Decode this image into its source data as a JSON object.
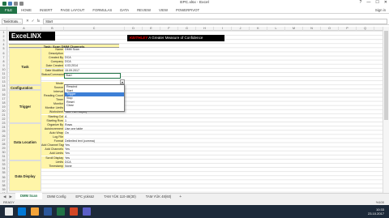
{
  "window": {
    "title": "EPC.xlsx - Excel",
    "controls": [
      "?",
      "—",
      "☐",
      "✕"
    ]
  },
  "ribbon": {
    "tabs": [
      "FILE",
      "HOME",
      "INSERT",
      "PAGE LAYOUT",
      "FORMULAS",
      "DATA",
      "REVIEW",
      "VIEW",
      "POWERPIVOT"
    ],
    "sign_in": "Sign in"
  },
  "formula_bar": {
    "name_box": "TaskStatu...",
    "fx": "fx",
    "value": "Start"
  },
  "columns": [
    "A",
    "B",
    "C",
    "D",
    "E",
    "F",
    "G",
    "H",
    "I",
    "J",
    "K",
    "L",
    "M",
    "N",
    "O",
    "P",
    "Q",
    "R",
    "S",
    "T",
    "U",
    "V",
    "W",
    "X"
  ],
  "rows": [
    "1",
    "2",
    "3",
    "4",
    "5",
    "6",
    "7",
    "8",
    "9",
    "10",
    "11",
    "12",
    "13",
    "14",
    "15",
    "16",
    "17",
    "18",
    "19",
    "20",
    "21",
    "22",
    "23",
    "24",
    "25",
    "26",
    "27",
    "28",
    "29",
    "30",
    "31",
    "32",
    "33",
    "34",
    "35",
    "36",
    "37",
    "38",
    "39",
    "40"
  ],
  "sheet": {
    "logo": {
      "prefix": "Exce",
      "suffix": "LINX"
    },
    "keithley": {
      "brand": "KEITHLEY",
      "tagline": "A Greater Measure of Confidence"
    },
    "task_header": "Task: Scan DMM Channels",
    "sections": {
      "task": "Task",
      "configuration": "Configuration",
      "trigger": "Trigger",
      "data_location": "Data Location",
      "data_display": "Data Display"
    },
    "rows": [
      {
        "label": "Name",
        "value": "DMM Scan"
      },
      {
        "label": "Description",
        "value": ""
      },
      {
        "label": "Created By",
        "value": "DCA"
      },
      {
        "label": "Company",
        "value": "DCA"
      },
      {
        "label": "Date Created",
        "value": "4.03.2014"
      },
      {
        "label": "Date Modified",
        "value": "15.09.2017"
      },
      {
        "label": "Status/Command",
        "value": "Start"
      },
      {
        "label": "Mode",
        "value": ""
      },
      {
        "label": "Source",
        "value": ""
      },
      {
        "label": "Interval",
        "value": ""
      },
      {
        "label": "Reading Count",
        "value": ""
      },
      {
        "label": "Timer",
        "value": "00:00"
      },
      {
        "label": "Monitor",
        "value": "None"
      },
      {
        "label": "Monitor Limits",
        "value": "None"
      },
      {
        "label": "Worksheet",
        "value": "TAM YÜK 48(60)"
      },
      {
        "label": "Starting Col",
        "value": "A"
      },
      {
        "label": "Starting Row",
        "value": "1"
      },
      {
        "label": "Organize By",
        "value": "Rows"
      },
      {
        "label": "Autoincrement",
        "value": "Use one table"
      },
      {
        "label": "Auto Wrap",
        "value": "On"
      },
      {
        "label": "Log File",
        "value": ""
      },
      {
        "label": "Format",
        "value": "Delimited text (comma)"
      },
      {
        "label": "Add Channel Tags",
        "value": "Yes"
      },
      {
        "label": "Add Channels",
        "value": "Yes"
      },
      {
        "label": "Add Limits",
        "value": "Yes"
      },
      {
        "label": "Scroll Display",
        "value": "Yes"
      },
      {
        "label": "Limits",
        "value": "DCA"
      },
      {
        "label": "Timestamp",
        "value": "None"
      }
    ],
    "dropdown": {
      "options": [
        "Rescind",
        "Start",
        "Trigger",
        "Stop",
        "Reset",
        "Clear"
      ],
      "selected_index": 2
    }
  },
  "sheet_tabs": {
    "tabs": [
      "DMM Scan",
      "DMM Config",
      "EPC yüksüz",
      "TAM YÜK 110-48(30)",
      "TAM YÜK 48(60)"
    ],
    "active_index": 0,
    "add": "+"
  },
  "status_bar": {
    "ready": "READY",
    "zoom": "%100"
  },
  "taskbar": {
    "time": "10:33",
    "date": "23.10.2017",
    "icon_colors": [
      "#0078d7",
      "#f2a33a",
      "#2b579a",
      "#217346",
      "#d24726",
      "#5b5fc7"
    ]
  }
}
